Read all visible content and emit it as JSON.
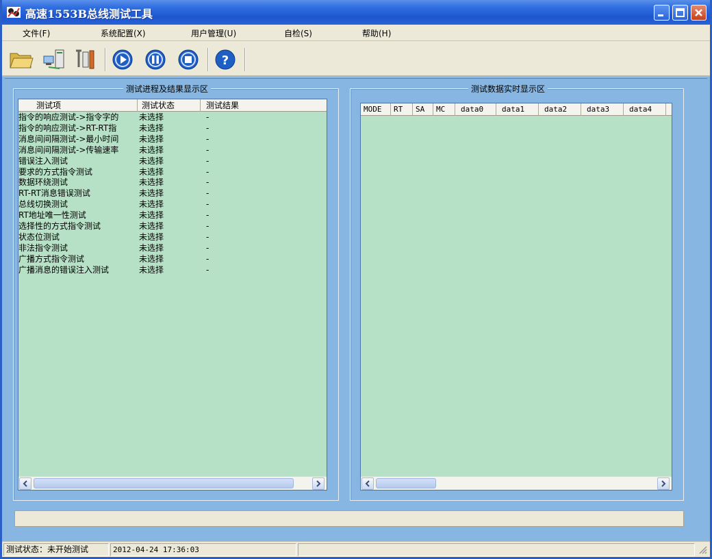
{
  "window": {
    "title": "高速1553B总线测试工具",
    "accent": "#2a63d6"
  },
  "menu": [
    {
      "label": "文件(F)"
    },
    {
      "label": "系统配置(X)"
    },
    {
      "label": "用户管理(U)"
    },
    {
      "label": "自检(S)"
    },
    {
      "label": "帮助(H)"
    }
  ],
  "toolbar": {
    "buttons": [
      "open-folder-icon",
      "network-computer-icon",
      "tools-icon",
      "play-icon",
      "pause-icon",
      "stop-icon",
      "help-icon"
    ]
  },
  "left_panel": {
    "title": "测试进程及结果显示区",
    "columns": [
      "测试项",
      "测试状态",
      "测试结果"
    ],
    "rows": [
      {
        "item": "指令的响应测试->指令字的",
        "status": "未选择",
        "result": "-"
      },
      {
        "item": "指令的响应测试->RT-RT指",
        "status": "未选择",
        "result": "-"
      },
      {
        "item": "消息间间隔测试->最小时间",
        "status": "未选择",
        "result": "-"
      },
      {
        "item": "消息间间隔测试->传输速率",
        "status": "未选择",
        "result": "-"
      },
      {
        "item": "错误注入测试",
        "status": "未选择",
        "result": "-"
      },
      {
        "item": "要求的方式指令测试",
        "status": "未选择",
        "result": "-"
      },
      {
        "item": "数据环绕测试",
        "status": "未选择",
        "result": "-"
      },
      {
        "item": "RT-RT消息错误测试",
        "status": "未选择",
        "result": "-"
      },
      {
        "item": "总线切换测试",
        "status": "未选择",
        "result": "-"
      },
      {
        "item": "RT地址唯一性测试",
        "status": "未选择",
        "result": "-"
      },
      {
        "item": "选择性的方式指令测试",
        "status": "未选择",
        "result": "-"
      },
      {
        "item": "状态位测试",
        "status": "未选择",
        "result": "-"
      },
      {
        "item": "非法指令测试",
        "status": "未选择",
        "result": "-"
      },
      {
        "item": "广播方式指令测试",
        "status": "未选择",
        "result": "-"
      },
      {
        "item": "广播消息的错误注入测试",
        "status": "未选择",
        "result": "-"
      }
    ]
  },
  "right_panel": {
    "title": "测试数据实时显示区",
    "columns": [
      "MODE",
      "RT",
      "SA",
      "MC",
      "data0",
      "data1",
      "data2",
      "data3",
      "data4"
    ]
  },
  "status_bar": {
    "status_text": "测试状态：未开始测试",
    "datetime": "2012-04-24 17:36:03"
  }
}
